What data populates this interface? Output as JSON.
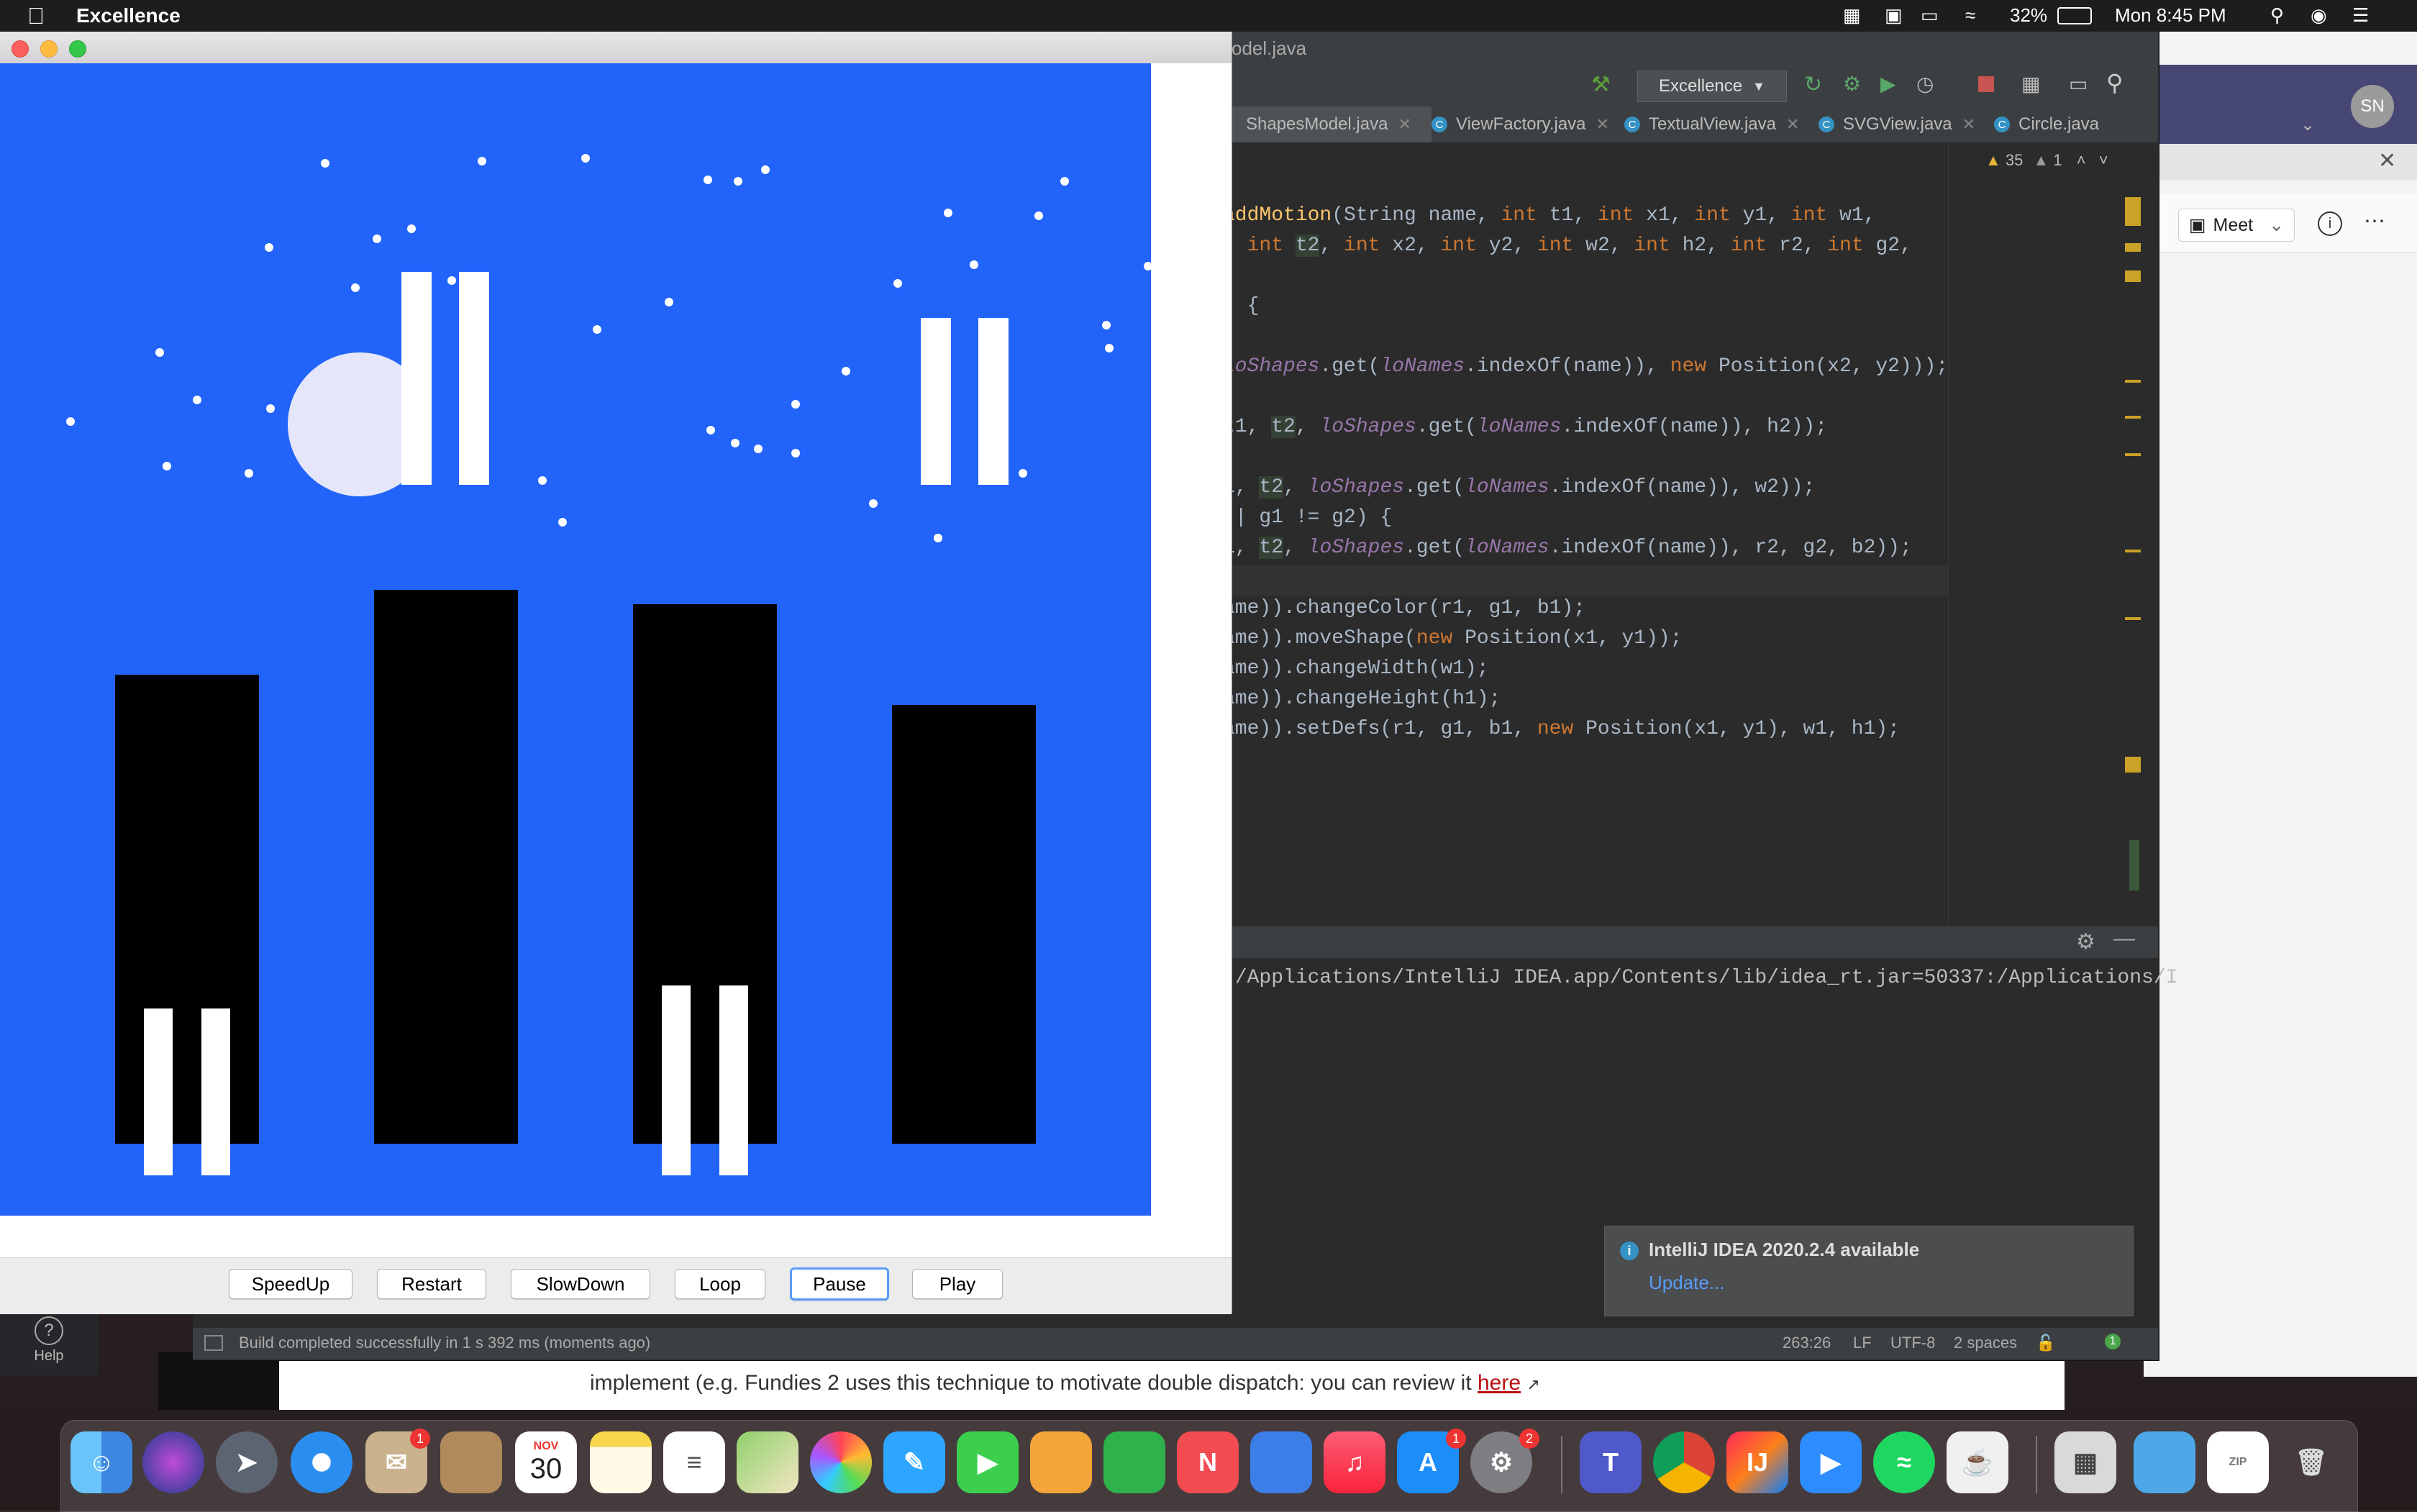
{
  "menubar": {
    "app_name": "Excellence",
    "battery": "32%",
    "clock": "Mon 8:45 PM"
  },
  "ide": {
    "title_partial": "odel.java",
    "run_config": "Excellence",
    "tabs": [
      {
        "label": "ShapesModel.java"
      },
      {
        "label": "ViewFactory.java"
      },
      {
        "label": "TextualView.java"
      },
      {
        "label": "SVGView.java"
      },
      {
        "label": "Circle.java"
      }
    ],
    "inspections": {
      "warnings": "35",
      "weak_warnings": "1"
    },
    "code": [
      "addMotion(String name, int t1, int x1, int y1, int w1,",
      ", int t2, int x2, int y2, int w2, int h2, int r2, int g2,",
      ") {",
      "loShapes.get(loNames.indexOf(name)), new Position(x2, y2)));",
      "t1, t2, loShapes.get(loNames.indexOf(name)), h2));",
      "1, t2, loShapes.get(loNames.indexOf(name)), w2));",
      "|| g1 != g2) {",
      "1, t2, loShapes.get(loNames.indexOf(name)), r2, g2, b2));",
      "ame)).changeColor(r1, g1, b1);",
      "ame)).moveShape(new Position(x1, y1));",
      "ame)).changeWidth(w1);",
      "ame)).changeHeight(h1);",
      "ame)).setDefs(r1, g1, b1, new Position(x1, y1), w1, h1);"
    ],
    "run_output": ":/Applications/IntelliJ IDEA.app/Contents/lib/idea_rt.jar=50337:/Applications/I",
    "status": {
      "message": "Build completed successfully in 1 s 392 ms (moments ago)",
      "position": "263:26",
      "line_sep": "LF",
      "encoding": "UTF-8",
      "indent": "2 spaces",
      "event_count": "1"
    },
    "notification": {
      "title": "IntelliJ IDEA 2020.2.4 available",
      "link": "Update..."
    }
  },
  "animation": {
    "buttons": [
      "SpeedUp",
      "Restart",
      "SlowDown",
      "Loop",
      "Pause",
      "Play"
    ],
    "focused_button": "Pause",
    "colors": {
      "sky": "#2264fa",
      "building": "#000000",
      "window": "#ffffff",
      "moon": "#e6e6fa"
    }
  },
  "browser": {
    "avatar": "SN",
    "meet_label": "Meet",
    "body_text_prefix": "implement (e.g. Fundies 2 uses this technique to motivate double dispatch: you can review it ",
    "body_link": "here"
  },
  "help": {
    "label": "Help"
  },
  "dock": {
    "calendar_month": "NOV",
    "calendar_day": "30",
    "badges": {
      "mail": "1",
      "appstore": "1",
      "prefs": "2"
    }
  }
}
